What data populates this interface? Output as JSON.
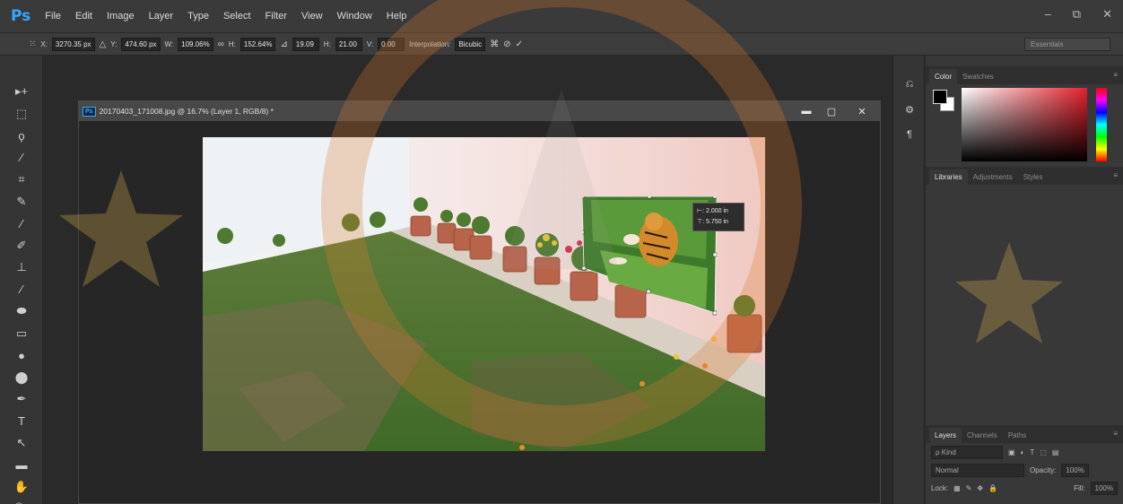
{
  "app": {
    "logo": "Ps",
    "menu": [
      "File",
      "Edit",
      "Image",
      "Layer",
      "Type",
      "Select",
      "Filter",
      "View",
      "Window",
      "Help"
    ],
    "window_controls": [
      "–",
      "⧉",
      "✕"
    ]
  },
  "options_bar": {
    "x_label": "X:",
    "x_value": "3270.35 px",
    "y_label": "Y:",
    "y_value": "474.60 px",
    "w_label": "W:",
    "w_value": "109.06%",
    "h_label": "H:",
    "h_value": "152.64%",
    "angle_value": "19.09",
    "hskew_label": "H:",
    "hskew_value": "21.00",
    "vskew_label": "V:",
    "vskew_value": "0.00",
    "interpolation_label": "Interpolation:",
    "interpolation_value": "Bicubic",
    "workspace": "Essentials"
  },
  "tools": [
    "▸+",
    "⬚",
    "ϙ",
    "⁄",
    "⌗",
    "✎",
    "⁄",
    "✐",
    "⊥",
    "⁄",
    "⬬",
    "▭",
    "●",
    "⬤",
    "✒",
    "T",
    "↖",
    "▬",
    "✋",
    "🔍"
  ],
  "document": {
    "badge": "Ps",
    "title": "20170403_171008.jpg @ 16.7% (Layer 1, RGB/8) *",
    "controls": [
      "▬",
      "▢",
      "✕"
    ]
  },
  "measure_tooltip": {
    "width": "⊢: 2.000 in",
    "height": "⊤: 5.750 in"
  },
  "panels": {
    "color_tabs": [
      "Color",
      "Swatches"
    ],
    "library_tabs": [
      "Libraries",
      "Adjustments",
      "Styles"
    ],
    "layers_tabs": [
      "Layers",
      "Channels",
      "Paths"
    ],
    "kind_filter": "ρ Kind",
    "blend_mode": "Normal",
    "opacity_label": "Opacity:",
    "opacity_value": "100%",
    "lock_label": "Lock:",
    "fill_label": "Fill:",
    "fill_value": "100%"
  },
  "colors": {
    "ps_blue": "#31a8ff",
    "foreground": "#000000",
    "background": "#ffffff",
    "watermark": "#e07a2a"
  }
}
